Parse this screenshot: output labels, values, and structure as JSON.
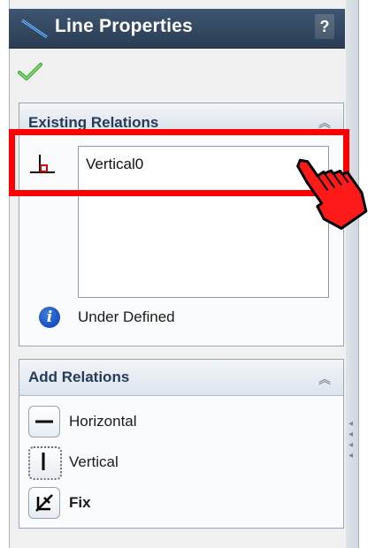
{
  "panel": {
    "title": "Line Properties",
    "help_label": "?"
  },
  "existing_relations": {
    "header": "Existing Relations",
    "items": [
      "Vertical0"
    ],
    "status": "Under Defined"
  },
  "add_relations": {
    "header": "Add Relations",
    "buttons": [
      {
        "label": "Horizontal",
        "icon": "horizontal-line-icon"
      },
      {
        "label": "Vertical",
        "icon": "vertical-line-icon"
      },
      {
        "label": "Fix",
        "icon": "fix-icon"
      }
    ]
  },
  "colors": {
    "title_bar": "#2f4560",
    "highlight": "#ff0000",
    "check": "#3aa832",
    "info": "#1d55c1"
  }
}
